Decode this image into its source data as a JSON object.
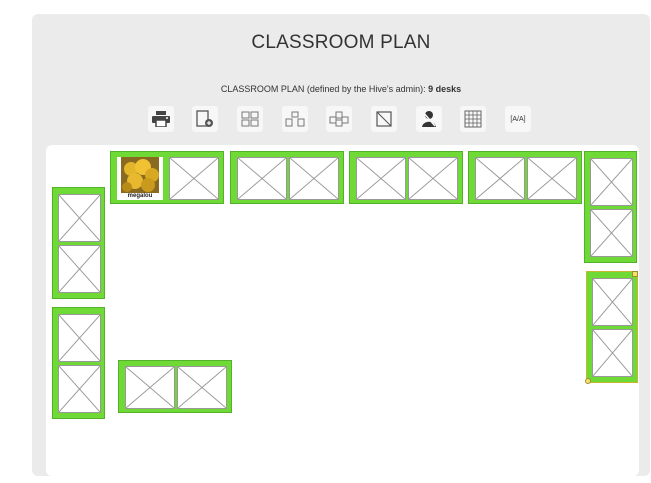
{
  "page": {
    "title": "CLASSROOM PLAN",
    "subtitle_prefix": "CLASSROOM PLAN (defined by the Hive's admin): ",
    "subtitle_count": "9 desks"
  },
  "toolbar": {
    "items": [
      {
        "icon": "printer-icon"
      },
      {
        "icon": "add-desk-icon"
      },
      {
        "icon": "desk-grid-icon"
      },
      {
        "icon": "desk-group-icon"
      },
      {
        "icon": "desk-cluster-icon"
      },
      {
        "icon": "empty-seat-icon"
      },
      {
        "icon": "student-icon"
      },
      {
        "icon": "grid-icon"
      },
      {
        "icon": "text-icon",
        "label": "[A/A]"
      }
    ]
  },
  "students": [
    {
      "name": "megalou"
    }
  ],
  "colors": {
    "desk_fill": "#6fd936",
    "desk_border": "#54b22a",
    "panel_bg": "#ebebeb",
    "handle": "#f3e26a"
  }
}
